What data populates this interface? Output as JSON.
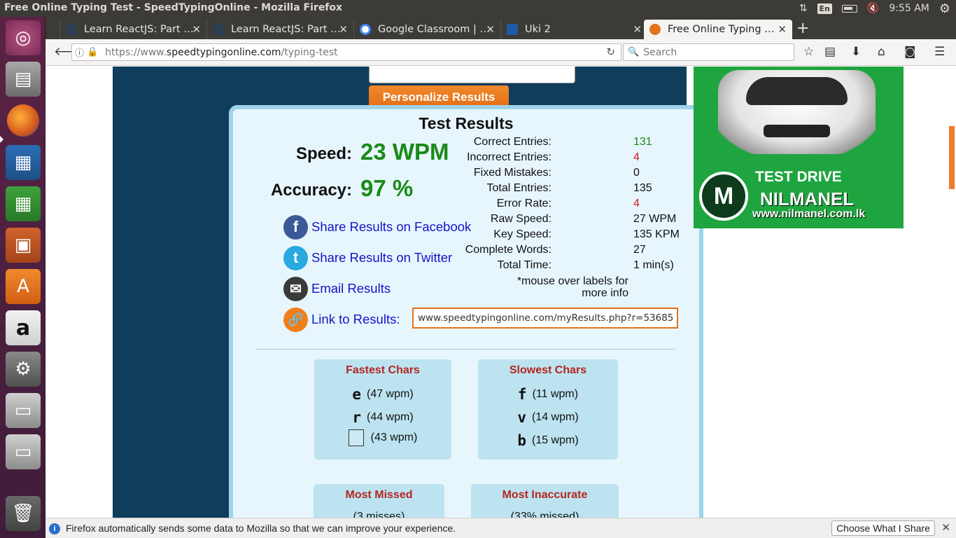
{
  "window": {
    "title": "Free Online Typing Test - SpeedTypingOnline - Mozilla Firefox"
  },
  "tray": {
    "lang": "En",
    "time": "9:55 AM"
  },
  "launcher": {
    "items": [
      "ubuntu-dash",
      "files",
      "firefox",
      "libreoffice-writer",
      "libreoffice-calc",
      "libreoffice-impress",
      "ubuntu-software",
      "amazon",
      "system-settings",
      "drive",
      "drive",
      "trash"
    ]
  },
  "tabs": [
    {
      "label": "Learn ReactJS: Part …",
      "color": "#2d3e50"
    },
    {
      "label": "Learn ReactJS: Part …",
      "color": "#2d3e50"
    },
    {
      "label": "Google Classroom | …",
      "color": "#4285f4"
    },
    {
      "label": "Uki 2",
      "color": "#1f5aa6"
    },
    {
      "label": "Free Online Typing …",
      "color": "#e5731a"
    }
  ],
  "navbar": {
    "url_prefix": "https://www.",
    "url_host": "speedtypingonline.com",
    "url_path": "/typing-test",
    "search_placeholder": "Search"
  },
  "page": {
    "personalize_label": "Personalize Results",
    "results": {
      "title": "Test Results",
      "speed_label": "Speed:",
      "speed_value": "23 WPM",
      "accuracy_label": "Accuracy:",
      "accuracy_value": "97 %",
      "share_facebook": "Share Results on Facebook",
      "share_twitter": "Share Results on Twitter",
      "email": "Email Results",
      "link_label": "Link to Results:",
      "link_value": "www.speedtypingonline.com/myResults.php?r=53685",
      "stats": [
        {
          "label": "Correct Entries:",
          "value": "131",
          "tone": "green"
        },
        {
          "label": "Incorrect Entries:",
          "value": "4",
          "tone": "red"
        },
        {
          "label": "Fixed Mistakes:",
          "value": "0",
          "tone": ""
        },
        {
          "label": "Total Entries:",
          "value": "135",
          "tone": ""
        },
        {
          "label": "Error Rate:",
          "value": "4",
          "tone": "red"
        },
        {
          "label": "Raw Speed:",
          "value": "27 WPM",
          "tone": ""
        },
        {
          "label": "Key Speed:",
          "value": "135 KPM",
          "tone": ""
        },
        {
          "label": "Complete Words:",
          "value": "27",
          "tone": ""
        },
        {
          "label": "Total Time:",
          "value": "1 min(s)",
          "tone": ""
        }
      ],
      "note": "*mouse over labels for more info",
      "fastest": {
        "title": "Fastest Chars",
        "rows": [
          {
            "char": "e",
            "wpm": "(47 wpm)"
          },
          {
            "char": "r",
            "wpm": "(44 wpm)"
          },
          {
            "char": " ",
            "wpm": "(43 wpm)"
          }
        ]
      },
      "slowest": {
        "title": "Slowest Chars",
        "rows": [
          {
            "char": "f",
            "wpm": "(11 wpm)"
          },
          {
            "char": "v",
            "wpm": "(14 wpm)"
          },
          {
            "char": "b",
            "wpm": "(15 wpm)"
          }
        ]
      },
      "most_missed": {
        "title": "Most Missed",
        "partial": "(3 misses)"
      },
      "most_inaccurate": {
        "title": "Most Inaccurate",
        "partial": "(33% missed)"
      }
    },
    "ad": {
      "line1": "TEST DRIVE",
      "line2": "NILMANEL",
      "line3": "www.nilmanel.com.lk"
    }
  },
  "notification": {
    "message": "Firefox automatically sends some data to Mozilla so that we can improve your experience.",
    "button": "Choose What I Share"
  }
}
